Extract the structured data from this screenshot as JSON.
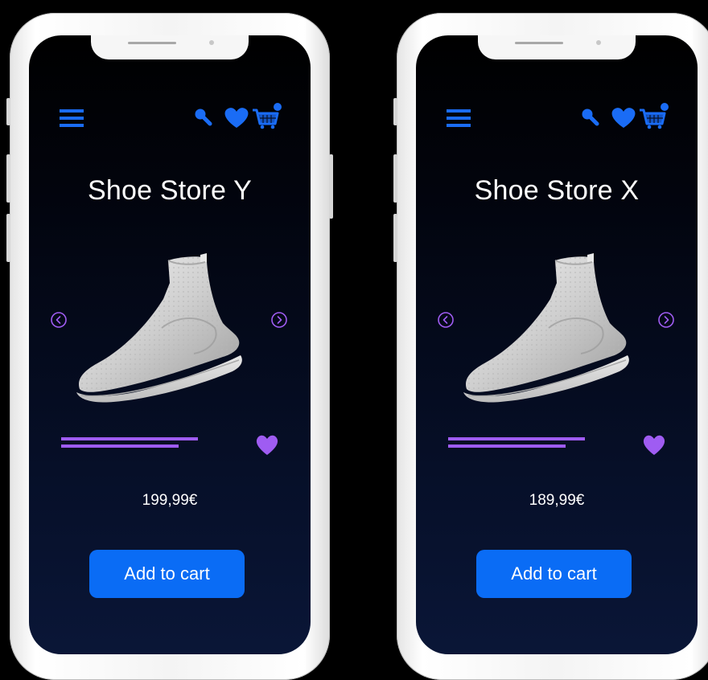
{
  "colors": {
    "accent_blue": "#0a6cf5",
    "accent_purple": "#9f5cf2",
    "screen_bg_top": "#000000",
    "screen_bg_bottom": "#0a1637"
  },
  "icons": [
    "menu-icon",
    "search-icon",
    "heart-icon",
    "cart-icon",
    "chevron-left-icon",
    "chevron-right-icon",
    "favorite-heart-icon"
  ],
  "phones": [
    {
      "store_title": "Shoe Store Y",
      "price": "199,99€",
      "add_to_cart_label": "Add to cart",
      "product_image": "white knit sock sneaker"
    },
    {
      "store_title": "Shoe Store X",
      "price": "189,99€",
      "add_to_cart_label": "Add to cart",
      "product_image": "white knit sock sneaker"
    }
  ]
}
